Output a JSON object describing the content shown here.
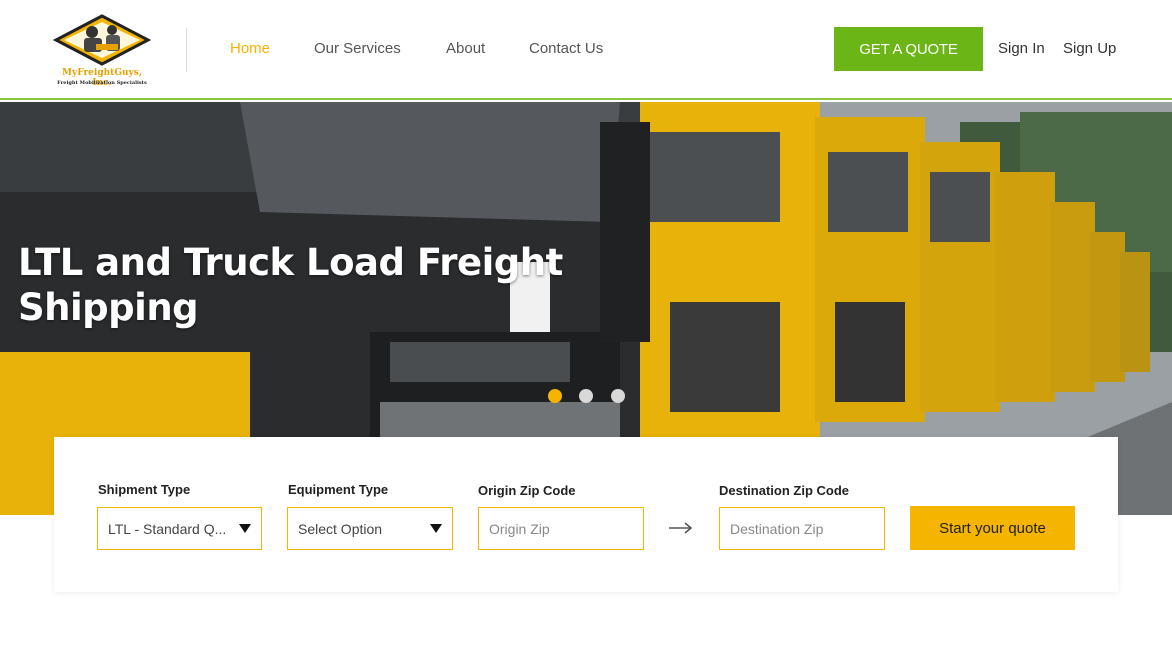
{
  "brand": {
    "name": "MyFreightGuys, Inc.",
    "tagline": "Freight Mobilization Specialists"
  },
  "nav": {
    "items": [
      {
        "label": "Home",
        "active": true
      },
      {
        "label": "Our Services",
        "active": false
      },
      {
        "label": "About",
        "active": false
      },
      {
        "label": "Contact Us",
        "active": false
      }
    ],
    "quote_button": "GET A QUOTE",
    "sign_in": "Sign In",
    "sign_up": "Sign Up"
  },
  "hero": {
    "title": "LTL and Truck Load Freight Shipping",
    "slides_total": 3,
    "active_slide": 1
  },
  "quote_form": {
    "shipment_type": {
      "label": "Shipment Type",
      "value": "LTL - Standard Q..."
    },
    "equipment_type": {
      "label": "Equipment Type",
      "value": "Select Option"
    },
    "origin_zip": {
      "label": "Origin Zip Code",
      "placeholder": "Origin Zip"
    },
    "destination_zip": {
      "label": "Destination Zip Code",
      "placeholder": "Destination Zip"
    },
    "submit_label": "Start your quote"
  },
  "colors": {
    "accent_yellow": "#f5b400",
    "accent_green": "#6bb516",
    "header_rule": "#8cc63f"
  },
  "icons": {
    "select_caret": "caret-down-icon",
    "route_arrow": "arrow-right-icon"
  }
}
